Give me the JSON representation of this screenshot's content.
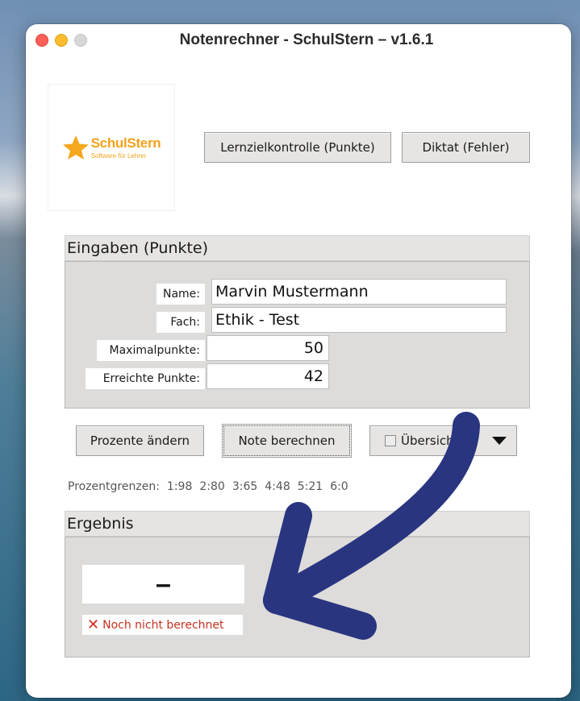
{
  "window": {
    "title": "Notenrechner - SchulStern – v1.6.1"
  },
  "logo": {
    "name": "SchulStern",
    "tagline": "Software für Lehrer"
  },
  "mode_buttons": {
    "lzk": "Lernzielkontrolle (Punkte)",
    "diktat": "Diktat (Fehler)"
  },
  "inputs": {
    "section_title": "Eingaben (Punkte)",
    "name_label": "Name:",
    "name_value": "Marvin Mustermann",
    "fach_label": "Fach:",
    "fach_value": "Ethik - Test",
    "max_label": "Maximalpunkte:",
    "max_value": "50",
    "reached_label": "Erreichte Punkte:",
    "reached_value": "42"
  },
  "actions": {
    "prozente": "Prozente ändern",
    "note": "Note berechnen",
    "uebersicht": "Übersich"
  },
  "grenzen": {
    "label": "Prozentgrenzen:",
    "items": [
      "1:98",
      "2:80",
      "3:65",
      "4:48",
      "5:21",
      "6:0"
    ]
  },
  "result": {
    "section_title": "Ergebnis",
    "grade": "–",
    "status": "Noch nicht berechnet"
  },
  "colors": {
    "arrow": "#2a3580",
    "status_red": "#c8311f",
    "logo_orange": "#f2a21b"
  }
}
